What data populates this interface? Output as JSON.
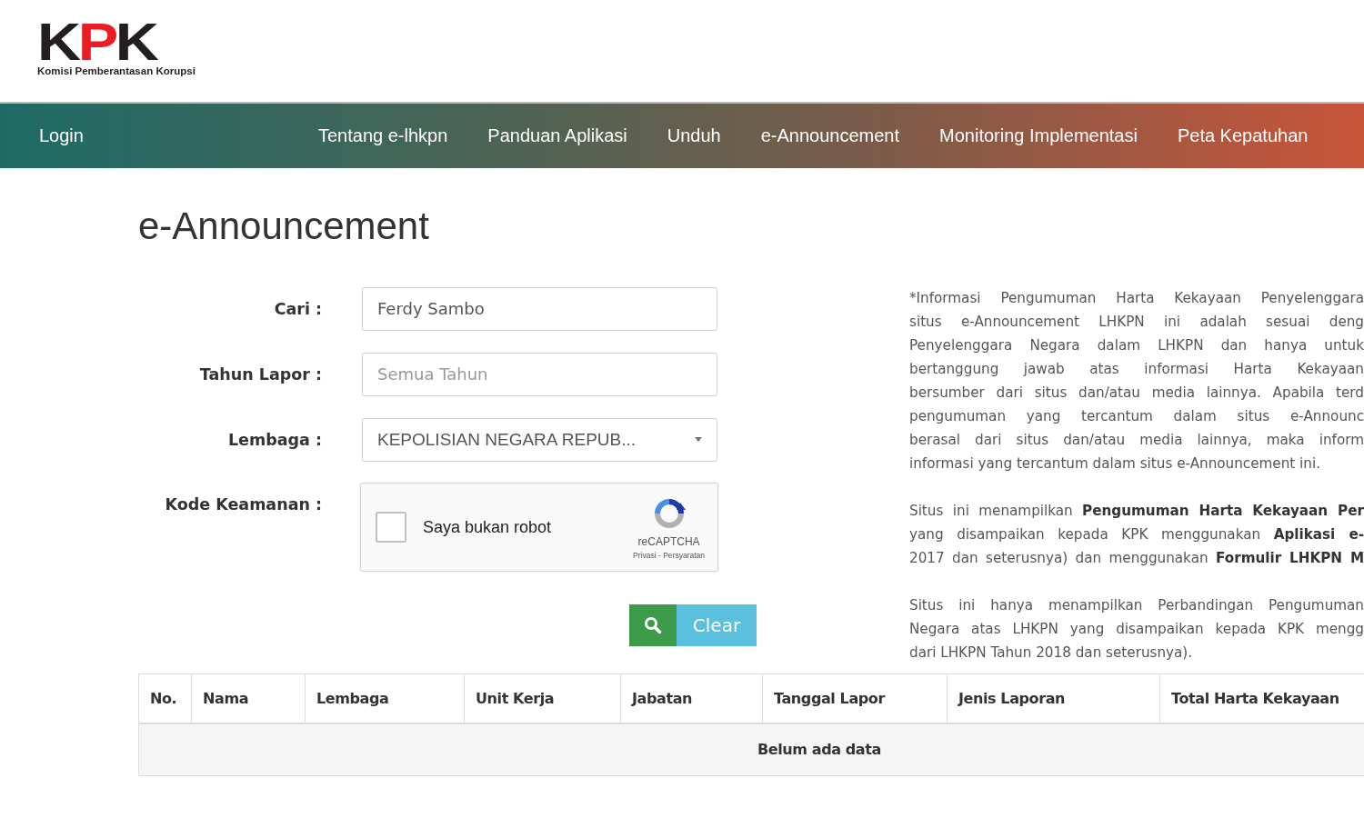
{
  "logo": {
    "letters": [
      {
        "text": "K",
        "color": "#231f20"
      },
      {
        "text": "P",
        "color": "#ed1c24"
      },
      {
        "text": "K",
        "color": "#231f20"
      }
    ],
    "subtitle": "Komisi Pemberantasan Korupsi"
  },
  "nav": {
    "login": "Login",
    "items": [
      "Tentang e-lhkpn",
      "Panduan Aplikasi",
      "Unduh",
      "e-Announcement",
      "Monitoring Implementasi",
      "Peta Kepatuhan"
    ]
  },
  "page_title": "e-Announcement",
  "form": {
    "fields": [
      {
        "kind": "text",
        "label": "Cari :",
        "value": "Ferdy Sambo"
      },
      {
        "kind": "text",
        "label": "Tahun Lapor :",
        "placeholder": "Semua Tahun"
      },
      {
        "kind": "select",
        "label": "Lembaga :",
        "value": "KEPOLISIAN NEGARA REPUB..."
      },
      {
        "kind": "captcha",
        "label": "Kode Keamanan :",
        "checkbox_label": "Saya bukan robot",
        "checked": false,
        "brand": "reCAPTCHA",
        "links": "Privasi - Persyaratan"
      }
    ],
    "clear_button": "Clear"
  },
  "info": [
    {
      "lines": [
        {
          "text": "*Informasi Pengumuman Harta Kekayaan Penyelenggara",
          "justified": true
        },
        {
          "text": "situs e-Announcement LHKPN ini adalah sesuai deng",
          "justified": true
        },
        {
          "text": "Penyelenggara Negara dalam LHKPN dan hanya untuk",
          "justified": true
        },
        {
          "text": "bertanggung jawab atas informasi Harta Kekayaan",
          "justified": true
        },
        {
          "text": "bersumber dari situs dan/atau media lainnya. Apabila terd",
          "justified": true
        },
        {
          "text": "pengumuman yang tercantum dalam situs e-Announc",
          "justified": true
        },
        {
          "text": "berasal dari situs dan/atau media lainnya, maka inform",
          "justified": true
        },
        {
          "text": "informasi yang tercantum dalam situs e-Announcement ini.",
          "justified": false
        }
      ]
    },
    {
      "lines": [
        {
          "text": "Situs ini menampilkan **Pengumuman Harta Kekayaan Per**",
          "justified": true
        },
        {
          "text": "yang disampaikan kepada KPK menggunakan **Aplikasi e-**",
          "justified": true
        },
        {
          "text": "2017 dan seterusnya) dan menggunakan **Formulir LHKPN M**",
          "justified": true
        }
      ]
    },
    {
      "lines": [
        {
          "text": "Situs ini hanya menampilkan Perbandingan Pengumuman",
          "justified": true
        },
        {
          "text": "Negara atas LHKPN yang disampaikan kepada KPK mengg",
          "justified": true
        },
        {
          "text": "dari LHKPN Tahun 2018 dan seterusnya).",
          "justified": false
        }
      ]
    }
  ],
  "table": {
    "columns": [
      "No.",
      "Nama",
      "Lembaga",
      "Unit Kerja",
      "Jabatan",
      "Tanggal Lapor",
      "Jenis Laporan",
      "Total Harta Kekayaan"
    ],
    "empty_message": "Belum ada data"
  }
}
